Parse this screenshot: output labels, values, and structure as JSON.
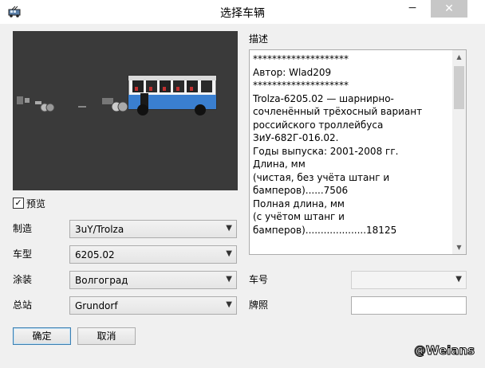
{
  "window": {
    "title": "选择车辆",
    "minimize_glyph": "−",
    "close_glyph": "✕"
  },
  "preview": {
    "checkbox_label": "预览",
    "checked": true,
    "check_glyph": "✓"
  },
  "fields": {
    "make_label": "制造",
    "make_value": "3uY/Trolza",
    "model_label": "车型",
    "model_value": "6205.02",
    "livery_label": "涂装",
    "livery_value": "Волгоград",
    "depot_label": "总站",
    "depot_value": "Grundorf",
    "fleet_number_label": "车号",
    "fleet_number_value": "",
    "plate_label": "牌照",
    "plate_value": ""
  },
  "description": {
    "label": "描述",
    "text": "********************\nАвтор: Wlad209\n********************\nTrolza-6205.02 — шарнирно-сочленённый трёхосный вариант российского троллейбуса ЗиУ-682Г-016.02.\nГоды выпуска: 2001-2008 гг.\nДлина, мм\n(чистая, без учёта штанг и бамперов)......7506\nПолная длина, мм\n(с учётом штанг и бамперов)....................18125"
  },
  "buttons": {
    "ok_label": "确定",
    "cancel_label": "取消"
  },
  "icons": {
    "dropdown_arrow": "▼",
    "scroll_up": "▲",
    "scroll_down": "▼"
  },
  "watermark": "@Weians",
  "colors": {
    "preview_background": "#3a3a3a",
    "bus_blue": "#3a7fd0",
    "bus_white": "#f4f4f4"
  }
}
